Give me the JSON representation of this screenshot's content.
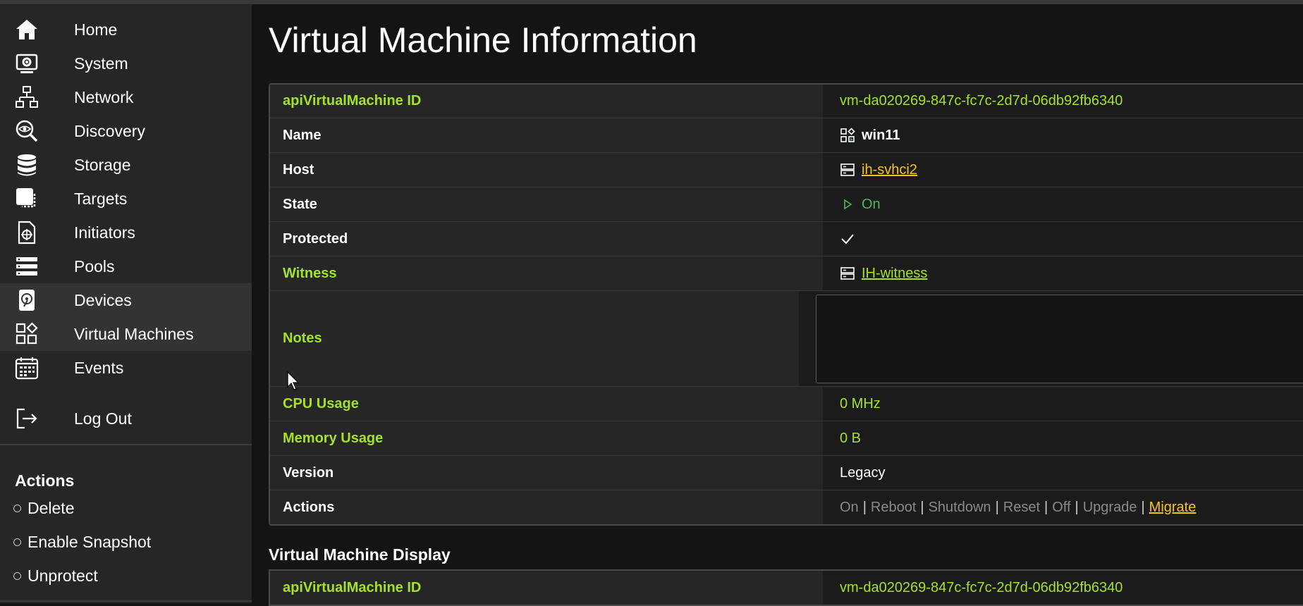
{
  "sidebar": {
    "nav": [
      {
        "label": "Home",
        "icon": "home-icon"
      },
      {
        "label": "System",
        "icon": "gear-monitor-icon"
      },
      {
        "label": "Network",
        "icon": "network-icon"
      },
      {
        "label": "Discovery",
        "icon": "discovery-eye-icon"
      },
      {
        "label": "Storage",
        "icon": "database-icon"
      },
      {
        "label": "Targets",
        "icon": "targets-icon"
      },
      {
        "label": "Initiators",
        "icon": "initiators-icon"
      },
      {
        "label": "Pools",
        "icon": "pools-icon"
      },
      {
        "label": "Devices",
        "icon": "disk-icon"
      },
      {
        "label": "Virtual Machines",
        "icon": "virtual-machines-icon"
      },
      {
        "label": "Events",
        "icon": "calendar-icon"
      },
      {
        "label": "Log Out",
        "icon": "logout-icon"
      }
    ],
    "actions_title": "Actions",
    "actions": [
      "Delete",
      "Enable Snapshot",
      "Unprotect"
    ]
  },
  "main": {
    "title": "Virtual Machine Information",
    "info": {
      "id_label": "apiVirtualMachine ID",
      "id_value": "vm-da020269-847c-fc7c-2d7d-06db92fb6340",
      "name_label": "Name",
      "name_value": "win11",
      "host_label": "Host",
      "host_value": "ih-svhci2",
      "state_label": "State",
      "state_value": "On",
      "protected_label": "Protected",
      "witness_label": "Witness",
      "witness_value": "IH-witness",
      "notes_label": "Notes",
      "notes_value": "",
      "cpu_label": "CPU Usage",
      "cpu_value": "0 MHz",
      "memory_label": "Memory Usage",
      "memory_value": "0 B",
      "version_label": "Version",
      "version_value": "Legacy",
      "actions_label": "Actions",
      "actions": {
        "on": "On",
        "reboot": "Reboot",
        "shutdown": "Shutdown",
        "reset": "Reset",
        "off": "Off",
        "upgrade": "Upgrade",
        "migrate": "Migrate",
        "separator": "|"
      }
    },
    "display_title": "Virtual Machine Display",
    "display": {
      "id_label": "apiVirtualMachine ID",
      "id_value": "vm-da020269-847c-fc7c-2d7d-06db92fb6340"
    }
  },
  "colors": {
    "accent_green": "#a4e22a",
    "state_green": "#4fb858",
    "link_yellow": "#f5c518"
  }
}
